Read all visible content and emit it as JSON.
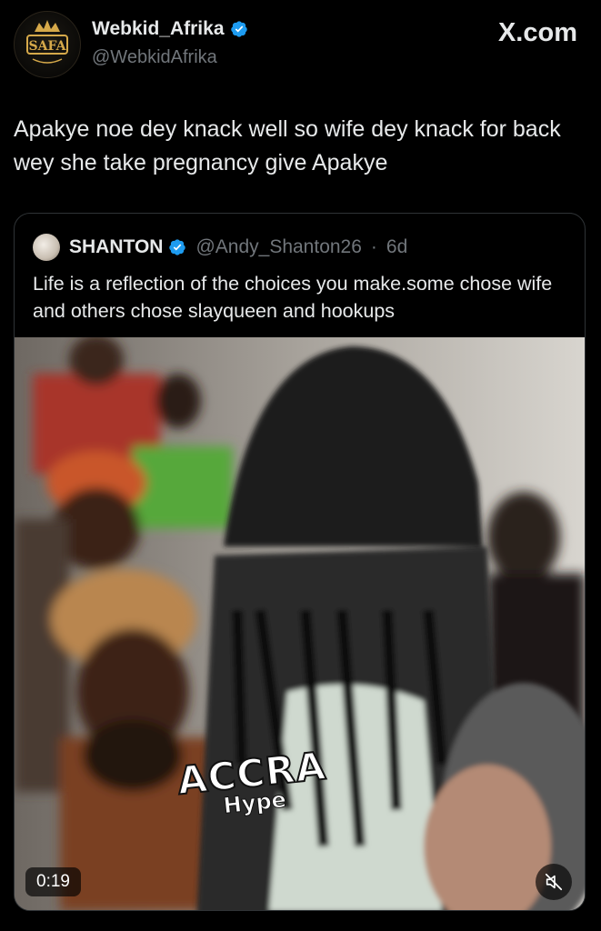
{
  "header": {
    "display_name": "Webkid_Afrika",
    "handle": "@WebkidAfrika",
    "site_label": "X.com",
    "avatar_text": "SAFA"
  },
  "tweet": {
    "text": "Apakye noe dey knack well so wife dey knack for back wey she take pregnancy give Apakye"
  },
  "quote": {
    "name": "SHANTON",
    "handle": "@Andy_Shanton26",
    "separator": "·",
    "time": "6d",
    "text": "Life is a reflection of the choices you make.some chose wife and others chose slayqueen and hookups",
    "video": {
      "duration": "0:19",
      "watermark_main": "ACCRA",
      "watermark_sub": "Hype",
      "mute_icon": "speaker-muted-icon"
    }
  },
  "colors": {
    "background": "#000000",
    "text": "#e7e9ea",
    "secondary_text": "#71767b",
    "verified_badge": "#1d9bf0",
    "border": "#2f3336"
  }
}
